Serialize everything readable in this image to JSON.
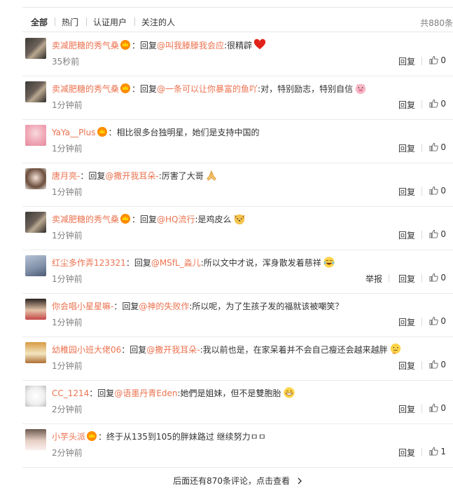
{
  "tabs": [
    {
      "label": "全部",
      "active": true
    },
    {
      "label": "热门",
      "active": false
    },
    {
      "label": "认证用户",
      "active": false
    },
    {
      "label": "关注的人",
      "active": false
    }
  ],
  "total_text": "共880条",
  "reply_label": "回复",
  "report_label": "举报",
  "colors": {
    "name": "#eb7350",
    "time": "#808080",
    "text": "#333333"
  },
  "comments": [
    {
      "user": "卖减肥糖的秀气桑",
      "vip": true,
      "prefix": "：回复",
      "mention": "@叫我滕滕我会应",
      "text": ":很精辟",
      "emoji": "red-heart",
      "time": "35秒前",
      "likes": "0",
      "report": false
    },
    {
      "user": "卖减肥糖的秀气桑",
      "vip": true,
      "prefix": "：回复",
      "mention": "@一条可以让你暴富的鱼吖",
      "text": ":对，特别励志，特别自信",
      "emoji": "pig-face",
      "time": "1分钟前",
      "likes": "0",
      "report": false
    },
    {
      "user": "YaYa__Plus",
      "vip": true,
      "prefix": "：",
      "mention": "",
      "text": "相比很多台独明星，她们是支持中国的",
      "emoji": "",
      "time": "1分钟前",
      "likes": "0",
      "report": false
    },
    {
      "user": "唐月亮-",
      "vip": false,
      "prefix": "：回复",
      "mention": "@撒开我耳朵-",
      "text": ":厉害了大哥",
      "emoji": "praying-hands",
      "time": "1分钟前",
      "likes": "0",
      "report": false
    },
    {
      "user": "卖减肥糖的秀气桑",
      "vip": true,
      "prefix": "：回复",
      "mention": "@HQ流行",
      "text": ":是鸡皮么",
      "emoji": "dog-face",
      "time": "1分钟前",
      "likes": "0",
      "report": false
    },
    {
      "user": "红尘多作弄123321",
      "vip": false,
      "prefix": "：回复",
      "mention": "@MSfL_淼儿",
      "text": ":所以文中才说，浑身散发着慈祥",
      "emoji": "laughing-face",
      "time": "1分钟前",
      "likes": "0",
      "report": true
    },
    {
      "user": "你会唱小星星嘛-",
      "vip": false,
      "prefix": "：回复",
      "mention": "@神的失败作",
      "text": ":所以呢，为了生孩子发的福就该被嘲笑？",
      "emoji": "",
      "time": "1分钟前",
      "likes": "0",
      "report": false
    },
    {
      "user": "幼稚园小班大佬06",
      "vip": false,
      "prefix": "：回复",
      "mention": "@撒开我耳朵-",
      "text": ":我以前也是，在家呆着并不会自己瘦还会越来越胖",
      "emoji": "thinking-face",
      "time": "1分钟前",
      "likes": "0",
      "report": false
    },
    {
      "user": "CC_1214",
      "vip": false,
      "prefix": "：回复",
      "mention": "@语墨丹青Eden",
      "text": ":她們是姐妹，但不是雙胞胎",
      "emoji": "grinning-face",
      "time": "2分钟前",
      "likes": "0",
      "report": false
    },
    {
      "user": "小芋头派",
      "vip": true,
      "prefix": "：",
      "mention": "",
      "text": "终于从135到105的胖妹路过 继续努力ㅁㅁ",
      "emoji": "",
      "time": "2分钟前",
      "likes": "1",
      "report": false
    }
  ],
  "more_text": "后面还有870条评论，点击查看"
}
